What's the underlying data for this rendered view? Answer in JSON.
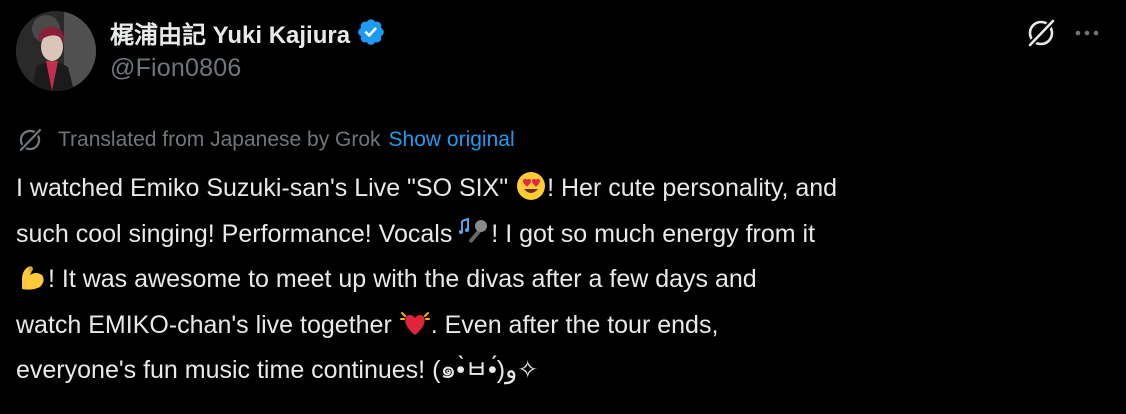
{
  "post": {
    "author": {
      "display_name": "梶浦由記 Yuki Kajiura",
      "handle": "@Fion0806",
      "avatar_icon": "profile-photo",
      "verified_icon": "verified-badge-icon",
      "verified_color": "#1d9bf0"
    },
    "actions": {
      "grok_icon": "grok-icon",
      "more_icon": "more-options-icon",
      "more_label": "···"
    },
    "translation": {
      "icon": "grok-icon",
      "label": "Translated from Japanese by Grok",
      "show_original": "Show original"
    },
    "text": {
      "line1_a": "I watched Emiko Suzuki-san's Live \"SO SIX\" ",
      "line1_b": "! Her cute personality, and",
      "line2_a": "such cool singing! Performance! Vocals ",
      "line2_b": "! I got so much energy from it",
      "line3_b": "! It was awesome to meet up with the divas after a few days and",
      "line4_a": "watch EMIKO-chan's live together ",
      "line4_b": ". Even after the tour ends,",
      "line5": "everyone's fun music time continues! (๑•̀ㅂ•́)و✧"
    },
    "emojis": {
      "e1": "heart-eyes-emoji",
      "e2": "music-microphone-emoji",
      "e3": "flexed-bicep-emoji",
      "e4": "beating-heart-emoji"
    },
    "colors": {
      "background": "#000000",
      "text": "#e7e9ea",
      "secondary_text": "#71767b",
      "link": "#1d9bf0"
    }
  }
}
